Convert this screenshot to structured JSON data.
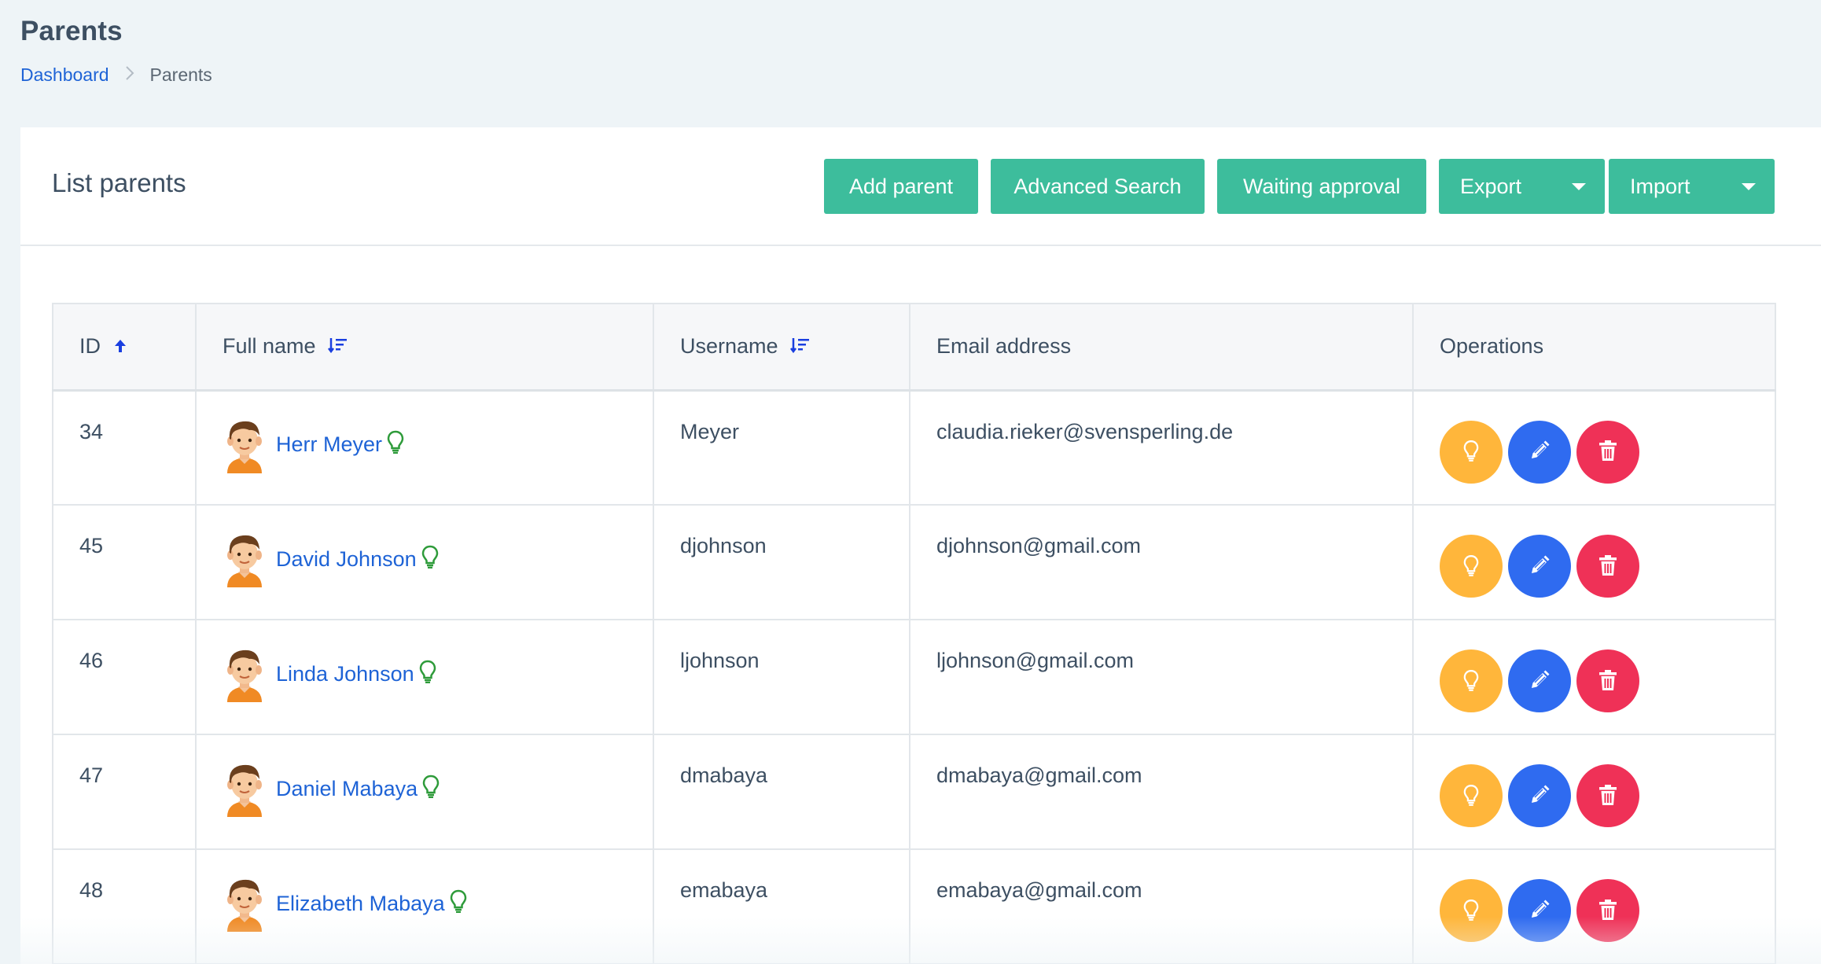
{
  "page": {
    "title": "Parents",
    "breadcrumb": {
      "home": "Dashboard",
      "current": "Parents"
    }
  },
  "card": {
    "title": "List parents",
    "buttons": {
      "add": "Add parent",
      "advanced_search": "Advanced Search",
      "waiting_approval": "Waiting approval",
      "export": "Export",
      "import": "Import"
    }
  },
  "table": {
    "headers": {
      "id": "ID",
      "full_name": "Full name",
      "username": "Username",
      "email": "Email address",
      "operations": "Operations"
    },
    "rows": [
      {
        "id": "34",
        "full_name": "Herr Meyer",
        "username": "Meyer",
        "email": "claudia.rieker@svensperling.de"
      },
      {
        "id": "45",
        "full_name": "David Johnson",
        "username": "djohnson",
        "email": "djohnson@gmail.com"
      },
      {
        "id": "46",
        "full_name": "Linda Johnson",
        "username": "ljohnson",
        "email": "ljohnson@gmail.com"
      },
      {
        "id": "47",
        "full_name": "Daniel Mabaya",
        "username": "dmabaya",
        "email": "dmabaya@gmail.com"
      },
      {
        "id": "48",
        "full_name": "Elizabeth Mabaya",
        "username": "emabaya",
        "email": "emabaya@gmail.com"
      }
    ]
  },
  "icons": {
    "sort_active": "arrow-up-icon",
    "sort_inactive": "sort-lines-icon",
    "status": "lightbulb-icon",
    "view": "lightbulb-icon",
    "edit": "pencil-icon",
    "delete": "trash-icon"
  },
  "colors": {
    "primary_button": "#3dbd9c",
    "link": "#1e63d6",
    "view": "#ffb63b",
    "edit": "#2f6bf0",
    "delete": "#ef3157",
    "status_bulb": "#2e9b3a"
  }
}
